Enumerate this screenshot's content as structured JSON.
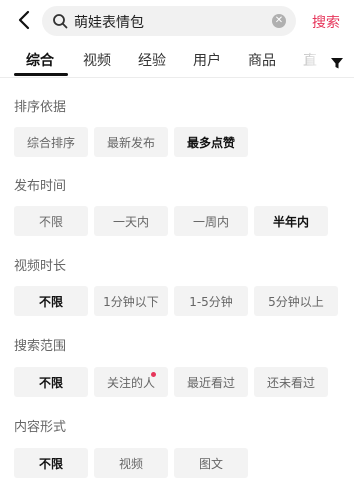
{
  "header": {
    "query": "萌娃表情包",
    "search_label": "搜索"
  },
  "tabs": [
    "综合",
    "视频",
    "经验",
    "用户",
    "商品",
    "直"
  ],
  "sections": {
    "sort": {
      "title": "排序依据",
      "options": [
        "综合排序",
        "最新发布",
        "最多点赞"
      ],
      "selected": "最多点赞"
    },
    "time": {
      "title": "发布时间",
      "options": [
        "不限",
        "一天内",
        "一周内",
        "半年内"
      ],
      "selected": "半年内"
    },
    "duration": {
      "title": "视频时长",
      "options": [
        "不限",
        "1分钟以下",
        "1-5分钟",
        "5分钟以上"
      ],
      "selected": "不限"
    },
    "scope": {
      "title": "搜索范围",
      "options": [
        "不限",
        "关注的人",
        "最近看过",
        "还未看过"
      ],
      "selected": "不限"
    },
    "format": {
      "title": "内容形式",
      "options": [
        "不限",
        "视频",
        "图文"
      ],
      "selected": "不限"
    }
  },
  "colors": {
    "accent": "#e6355a",
    "chip_bg": "#f3f3f3"
  },
  "icons": {
    "back": "back-arrow-icon",
    "search": "search-icon",
    "clear": "clear-icon",
    "filter": "filter-icon"
  }
}
